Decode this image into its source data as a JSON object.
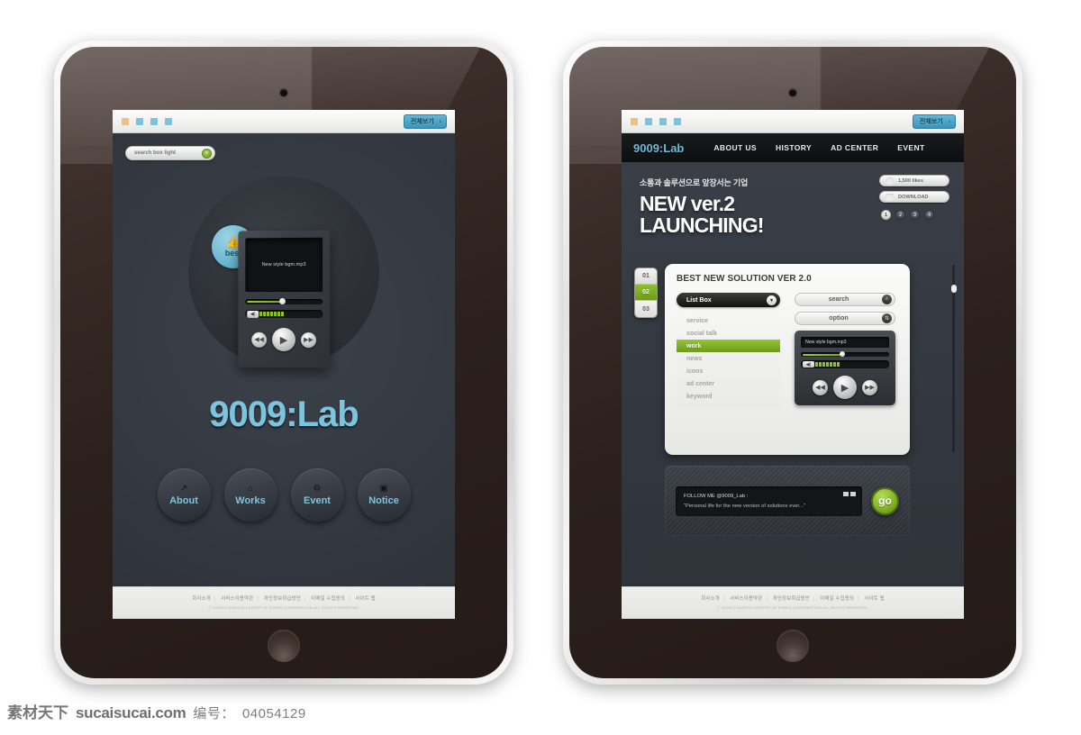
{
  "browser_chrome": {
    "dots": [
      "#e8c288",
      "#7dc3dd",
      "#7dc3dd",
      "#7dc3dd"
    ],
    "view_all_label": "전체보기",
    "view_all_arrow": "›"
  },
  "left_tablet": {
    "search": {
      "placeholder": "search box light",
      "icon": "search-icon",
      "icon_glyph": "⌕"
    },
    "badge": {
      "thumb_glyph": "👍",
      "label": "best"
    },
    "player": {
      "track_title": "New style bgm.mp3",
      "seek_percent": 46,
      "volume_bars": 7,
      "prev_glyph": "◀◀",
      "play_glyph": "▶",
      "next_glyph": "▶▶",
      "speaker_glyph": "◀)"
    },
    "brand": "9009:Lab",
    "nav": [
      {
        "label": "About",
        "icon": "arrow-up-right-icon",
        "glyph": "↗"
      },
      {
        "label": "Works",
        "icon": "home-icon",
        "glyph": "⌂"
      },
      {
        "label": "Event",
        "icon": "gear-icon",
        "glyph": "⚙"
      },
      {
        "label": "Notice",
        "icon": "window-icon",
        "glyph": "▣"
      }
    ]
  },
  "right_tablet": {
    "topnav": {
      "logo": "9009:Lab",
      "items": [
        "ABOUT US",
        "HISTORY",
        "AD CENTER",
        "EVENT"
      ]
    },
    "hero": {
      "kicker": "소통과 솔루션으로 앞장서는 기업",
      "line1": "NEW ver.2",
      "line2": "LAUNCHING!"
    },
    "pills": [
      {
        "label": "1,500 likes",
        "icon": "heart-icon"
      },
      {
        "label": "DOWNLOAD",
        "icon": "download-icon"
      }
    ],
    "pagination": [
      "1",
      "2",
      "3",
      "4"
    ],
    "pagination_active": "1",
    "steps": [
      "01",
      "02",
      "03"
    ],
    "step_active": "02",
    "panel": {
      "title": "BEST NEW SOLUTION VER 2.0",
      "list_header": "List Box",
      "list_chevron": "▾",
      "list_items": [
        "service",
        "social talk",
        "work",
        "news",
        "icons",
        "ad center",
        "keyword"
      ],
      "list_selected": "work",
      "search_field": {
        "label": "search",
        "icon": "search-icon",
        "glyph": "⌕"
      },
      "option_field": {
        "label": "option",
        "icon": "updown-icon",
        "glyph": "⇅"
      },
      "player": {
        "track_title": "New style bgm.mp3",
        "seek_percent": 46,
        "volume_bars": 7,
        "prev_glyph": "◀◀",
        "play_glyph": "▶",
        "next_glyph": "▶▶",
        "speaker_glyph": "◀)"
      }
    },
    "social": {
      "line1": "FOLLOW ME @9009_Lab :",
      "line2": "\"Personal life for the new version of solutions ever...\"",
      "go_label": "go"
    }
  },
  "footer": {
    "links": [
      "회사소개",
      "서비스이용약관",
      "개인정보취급방안",
      "이메일 수집동의",
      "사이트 맵"
    ],
    "separator": "|",
    "copyright": "ⓒ WORLD BARISTA CENTER OF KOREA CORPORATION.ALL RIGHTS RESERVED."
  },
  "watermark": {
    "site_cn": "素材天下",
    "site_url": "sucaisucai.com",
    "id_label": "编号：",
    "id_value": "04054129"
  },
  "colors": {
    "accent_blue": "#7cc3dd",
    "accent_green": "#8ec02f",
    "screen_bg": "#363b42",
    "bezel": "#2b201c"
  }
}
